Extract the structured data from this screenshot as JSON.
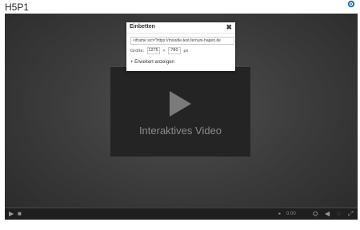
{
  "page": {
    "title": "H5P1"
  },
  "video": {
    "title": "Interaktives Video",
    "time": "0:00"
  },
  "dialog": {
    "title": "Einbetten",
    "close": "✖",
    "embed_code": "<iframe src=\"https://moodle-test.fernuni-hagen.de",
    "size_label": "Größe:",
    "width": "1275",
    "times": "×",
    "height": "780",
    "unit": "px",
    "advanced_label": "+ Erweitert anzeigen"
  },
  "icons": {
    "settings": "gear-icon",
    "play": "play-icon",
    "stop": "stop-icon",
    "bookmark": "bookmark-icon",
    "quality": "quality-icon",
    "volume": "volume-icon",
    "captions": "captions-icon",
    "fullscreen": "fullscreen-icon"
  },
  "colors": {
    "accent": "#1f6fb5",
    "player_bg": "#3a3a3a",
    "controls_bg": "#1f1f1f"
  }
}
